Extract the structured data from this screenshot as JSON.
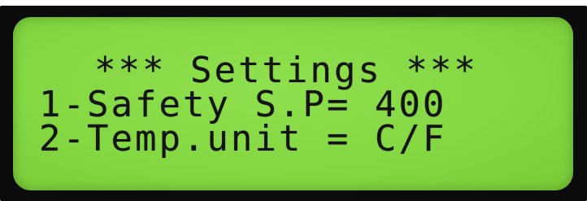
{
  "display": {
    "lines": [
      "*** Settings ***",
      "1-Safety S.P= 400",
      "2-Temp.unit = C/F"
    ]
  },
  "colors": {
    "bezel": "#0b0b0b",
    "lcd_background": "#84d842",
    "lcd_text": "#141414"
  }
}
